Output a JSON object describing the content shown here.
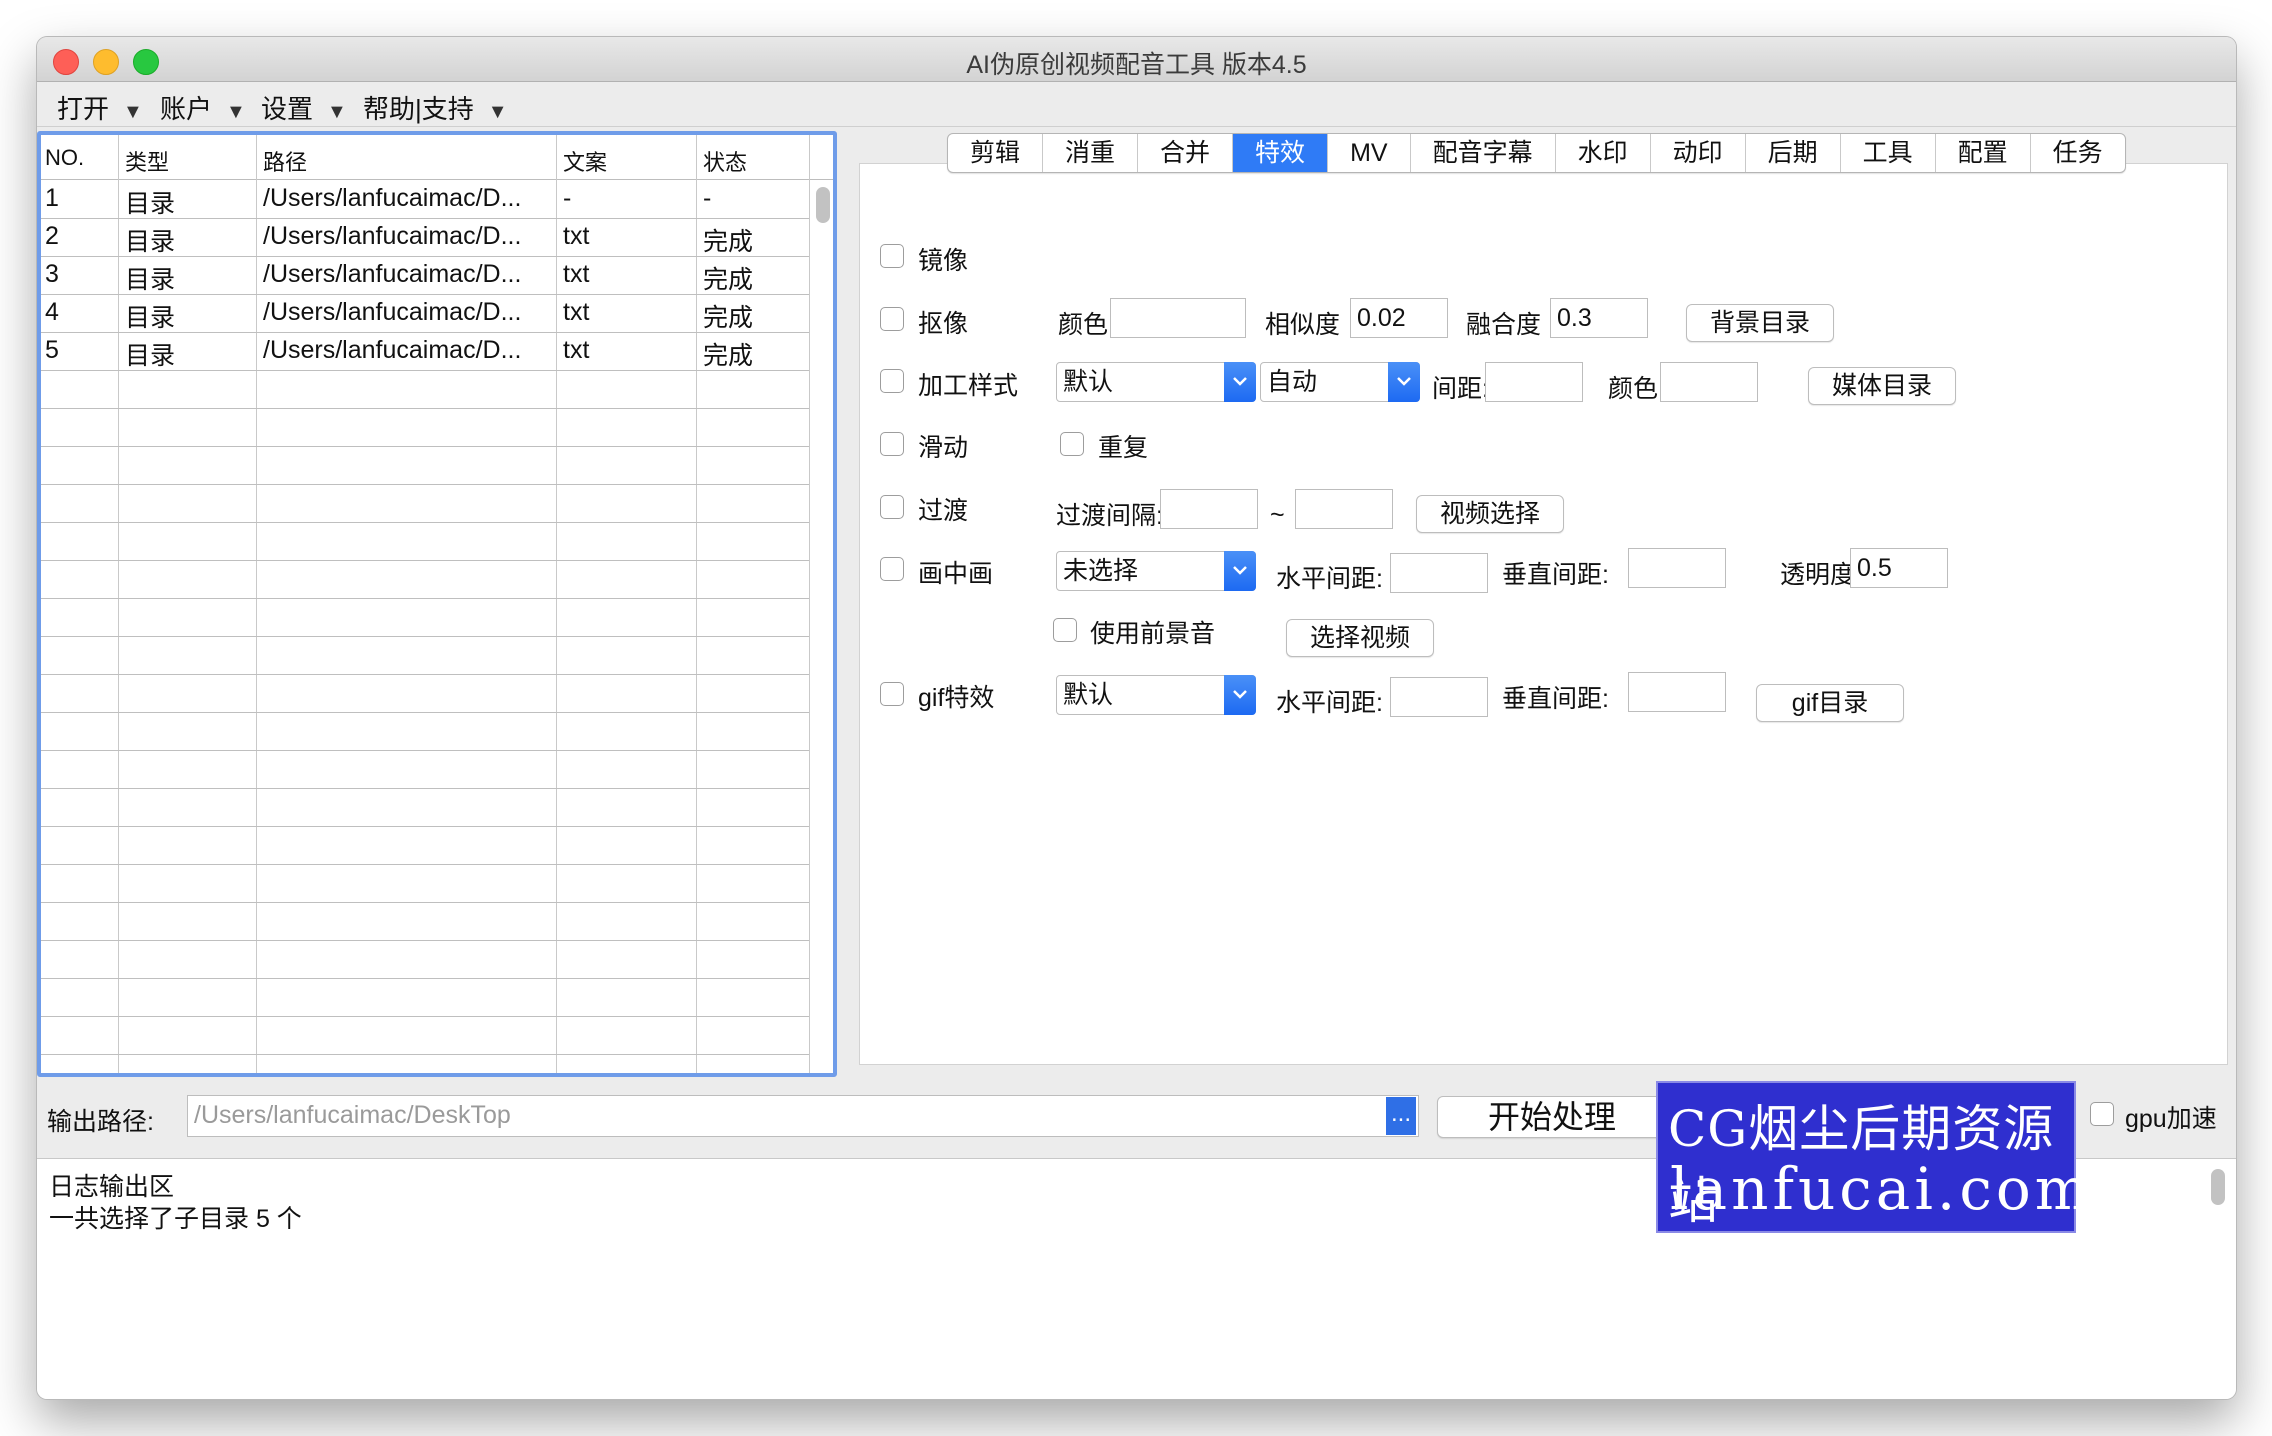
{
  "window": {
    "title": "AI伪原创视频配音工具  版本4.5"
  },
  "menu": [
    {
      "label": "打开"
    },
    {
      "label": "账户"
    },
    {
      "label": "设置"
    },
    {
      "label": "帮助|支持"
    }
  ],
  "menu_arrow": "▼",
  "table": {
    "headers": [
      "NO.",
      "类型",
      "路径",
      "文案",
      "状态"
    ],
    "rows": [
      [
        "1",
        "目录",
        "/Users/lanfucaimac/D...",
        "-",
        "-"
      ],
      [
        "2",
        "目录",
        "/Users/lanfucaimac/D...",
        "txt",
        "完成"
      ],
      [
        "3",
        "目录",
        "/Users/lanfucaimac/D...",
        "txt",
        "完成"
      ],
      [
        "4",
        "目录",
        "/Users/lanfucaimac/D...",
        "txt",
        "完成"
      ],
      [
        "5",
        "目录",
        "/Users/lanfucaimac/D...",
        "txt",
        "完成"
      ]
    ]
  },
  "tabs": [
    "剪辑",
    "消重",
    "合并",
    "特效",
    "MV",
    "配音字幕",
    "水印",
    "动印",
    "后期",
    "工具",
    "配置",
    "任务"
  ],
  "active_tab": "特效",
  "effects": {
    "mirror": "镜像",
    "keying": "抠像",
    "color_label": "颜色",
    "similarity_label": "相似度",
    "similarity_value": "0.02",
    "blend_label": "融合度",
    "blend_value": "0.3",
    "bg_dir_button": "背景目录",
    "process_style": "加工样式",
    "style_select": "默认",
    "auto_select": "自动",
    "spacing_label": "间距:",
    "color2_label": "颜色:",
    "media_dir_button": "媒体目录",
    "slide": "滑动",
    "repeat": "重复",
    "transition": "过渡",
    "transition_interval": "过渡间隔:",
    "tilde": "~",
    "video_select_button": "视频选择",
    "pip": "画中画",
    "pip_select": "未选择",
    "h_spacing": "水平间距:",
    "v_spacing": "垂直间距:",
    "opacity_label": "透明度:",
    "opacity_value": "0.5",
    "use_fg_audio": "使用前景音",
    "select_video_button": "选择视频",
    "gif": "gif特效",
    "gif_select": "默认",
    "gif_h_spacing": "水平间距:",
    "gif_v_spacing": "垂直间距:",
    "gif_dir_button": "gif目录"
  },
  "output": {
    "label": "输出路径:",
    "path": "/Users/lanfucaimac/DeskTop",
    "browse": "...",
    "start_button": "开始处理",
    "gpu_label": "gpu加速"
  },
  "log": {
    "lines": [
      "日志输出区",
      "一共选择了子目录 5 个"
    ]
  },
  "watermark": {
    "line1": "CG烟尘后期资源站",
    "line2": "lanfucai.com"
  },
  "colors": {
    "accent": "#2f7bf6",
    "focus_ring": "#6f9ce9"
  }
}
